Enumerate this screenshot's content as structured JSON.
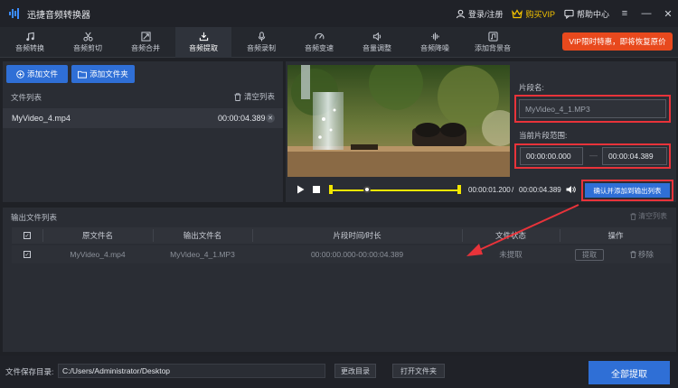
{
  "app": {
    "title": "迅捷音频转换器",
    "login": "登录/注册",
    "buy_vip": "购买VIP",
    "help": "帮助中心",
    "colors": {
      "accent": "#2f6fd6",
      "promo": "#e8491d",
      "vip": "#f5c400",
      "highlight": "#e8333a"
    }
  },
  "toolbar": {
    "tabs": [
      {
        "label": "音频转换",
        "icon": "music-note-icon"
      },
      {
        "label": "音频剪切",
        "icon": "scissors-icon"
      },
      {
        "label": "音频合并",
        "icon": "merge-icon"
      },
      {
        "label": "音频提取",
        "icon": "extract-icon",
        "active": true
      },
      {
        "label": "音频录制",
        "icon": "microphone-icon"
      },
      {
        "label": "音频变速",
        "icon": "speed-icon"
      },
      {
        "label": "音量调整",
        "icon": "volume-icon"
      },
      {
        "label": "音频降噪",
        "icon": "denoise-icon"
      },
      {
        "label": "添加背景音",
        "icon": "background-music-icon"
      }
    ],
    "promo": "VIP限时特惠，即将恢复原价"
  },
  "file_panel": {
    "add_file": "添加文件",
    "add_folder": "添加文件夹",
    "list_title": "文件列表",
    "clear_list": "清空列表",
    "files": [
      {
        "name": "MyVideo_4.mp4",
        "duration": "00:00:04.389"
      }
    ]
  },
  "preview": {
    "current_time": "00:00:01.200",
    "separator": "/",
    "total_time": "00:00:04.389",
    "progress": 0.27
  },
  "segment": {
    "name_label": "片段名:",
    "name_value": "MyVideo_4_1.MP3",
    "range_label": "当前片段范围:",
    "start": "00:00:00.000",
    "dash": "—",
    "end": "00:00:04.389",
    "confirm": "确认并添加到输出列表"
  },
  "output": {
    "title": "输出文件列表",
    "clear": "清空列表",
    "columns": [
      "原文件名",
      "输出文件名",
      "片段时间/时长",
      "文件状态",
      "操作"
    ],
    "rows": [
      {
        "source": "MyVideo_4.mp4",
        "output": "MyVideo_4_1.MP3",
        "range": "00:00:00.000-00:00:04.389",
        "status": "未提取",
        "extract": "提取",
        "remove": "移除"
      }
    ]
  },
  "bottom": {
    "save_label": "文件保存目录:",
    "save_path": "C:/Users/Administrator/Desktop",
    "change_dir": "更改目录",
    "open_folder": "打开文件夹",
    "extract_all": "全部提取"
  }
}
